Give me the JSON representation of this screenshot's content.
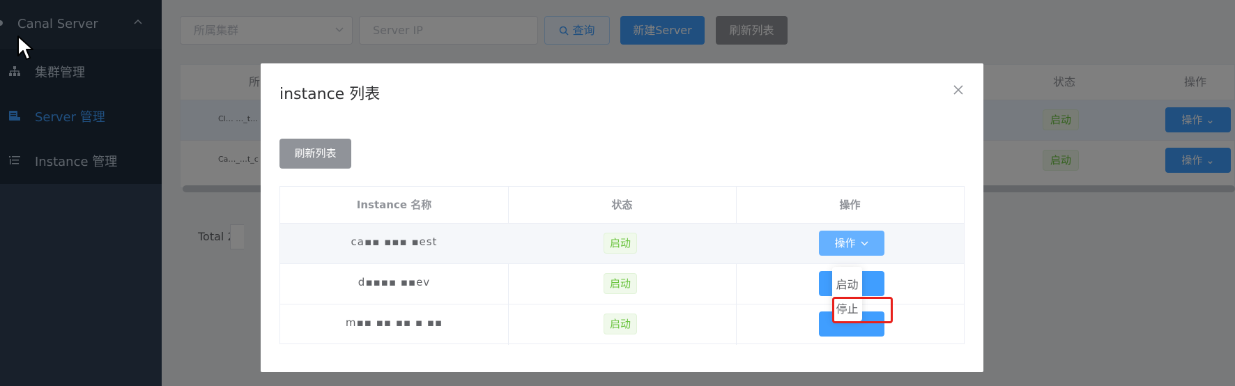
{
  "sidebar": {
    "title": "Canal Server",
    "items": [
      {
        "label": "集群管理",
        "icon": "cluster-icon"
      },
      {
        "label": "Server 管理",
        "icon": "server-icon"
      },
      {
        "label": "Instance 管理",
        "icon": "list-icon"
      }
    ],
    "active_index": 1
  },
  "toolbar": {
    "cluster_placeholder": "所属集群",
    "ip_placeholder": "Server IP",
    "search_label": "查询",
    "new_label": "新建Server",
    "refresh_label": "刷新列表"
  },
  "background_table": {
    "columns": [
      "所",
      "状态",
      "操作"
    ],
    "rows": [
      {
        "name": "Cl… …_t…",
        "status": "启动",
        "op": "操作"
      },
      {
        "name": "Ca…_…t_c",
        "status": "启动",
        "op": "操作"
      }
    ],
    "total": "Total 2"
  },
  "dialog": {
    "title": "instance 列表",
    "refresh_label": "刷新列表",
    "columns": [
      "Instance 名称",
      "状态",
      "操作"
    ],
    "rows": [
      {
        "name": "ca▪▪ ▪▪▪ ▪est",
        "status": "启动",
        "op": "操作"
      },
      {
        "name": "d▪▪▪▪ ▪▪ev",
        "status": "启动",
        "op": ""
      },
      {
        "name": "m▪▪ ▪▪ ▪▪ ▪ ▪▪",
        "status": "启动",
        "op": ""
      }
    ]
  },
  "dropdown": {
    "items": [
      "启动",
      "停止"
    ]
  },
  "colors": {
    "primary": "#409eff",
    "success": "#67c23a",
    "sidebar_bg": "#304156",
    "highlight": "#e8211c"
  }
}
